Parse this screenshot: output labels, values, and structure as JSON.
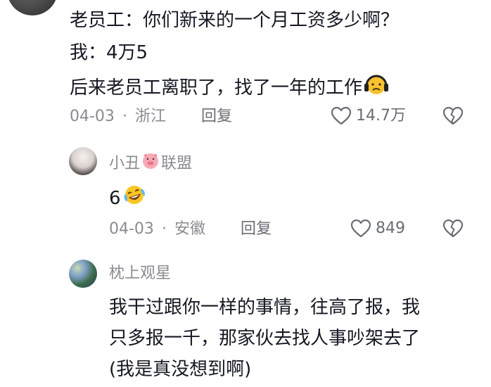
{
  "comment1": {
    "lines": [
      "老员工：你们新来的一个月工资多少啊？",
      "我：4万5",
      "后来老员工离职了，找了一年的工作"
    ],
    "date": "04-03",
    "dot": "·",
    "location": "浙江",
    "reply_label": "回复",
    "like_count": "14.7万"
  },
  "comment2": {
    "username_part1": "小丑",
    "username_part2": "联盟",
    "text": "6",
    "date": "04-03",
    "dot": "·",
    "location": "安徽",
    "reply_label": "回复",
    "like_count": "849"
  },
  "comment3": {
    "username": "枕上观星",
    "lines": [
      "我干过跟你一样的事情，往高了报，我",
      "只多报一千，那家伙去找人事吵架去了",
      "(我是真没想到啊)"
    ]
  },
  "colors": {
    "text_primary": "#161823",
    "text_meta": "#8a8b91",
    "text_action": "#6b6d75"
  },
  "icons": {
    "like": "heart-outline-icon",
    "dislike": "broken-heart-icon",
    "emoji_headphones": "headphones-face-emoji",
    "emoji_laugh": "laugh-crying-emoji",
    "emoji_pig": "pig-face-emoji"
  }
}
